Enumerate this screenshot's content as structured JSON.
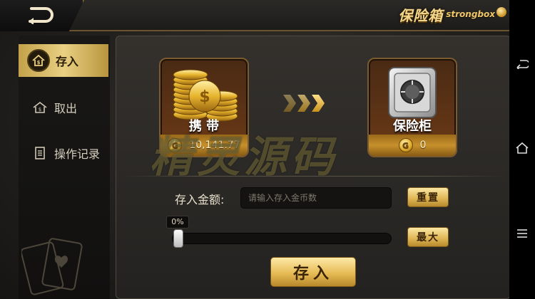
{
  "header": {
    "title_cn": "保险箱",
    "title_en": "strongbox"
  },
  "sidebar": {
    "items": [
      {
        "label": "存入",
        "icon": "deposit-house-icon",
        "active": true
      },
      {
        "label": "取出",
        "icon": "withdraw-house-icon",
        "active": false
      },
      {
        "label": "操作记录",
        "icon": "record-list-icon",
        "active": false
      }
    ]
  },
  "carry": {
    "label": "携 带",
    "amount": "10,141.77",
    "coin_glyph": "G"
  },
  "safe": {
    "label": "保险柜",
    "amount": "0",
    "coin_glyph": "G"
  },
  "form": {
    "amount_label": "存入金额:",
    "amount_placeholder": "请输入存入金币数",
    "reset_label": "重置",
    "max_label": "最大",
    "deposit_label": "存入"
  },
  "slider": {
    "percent_text": "0%",
    "fraction": 0
  },
  "watermark": "精灵源码",
  "colors": {
    "gold": "#e1b858",
    "panel": "#2a2825",
    "sidebar_active": "#d9bd6a"
  }
}
